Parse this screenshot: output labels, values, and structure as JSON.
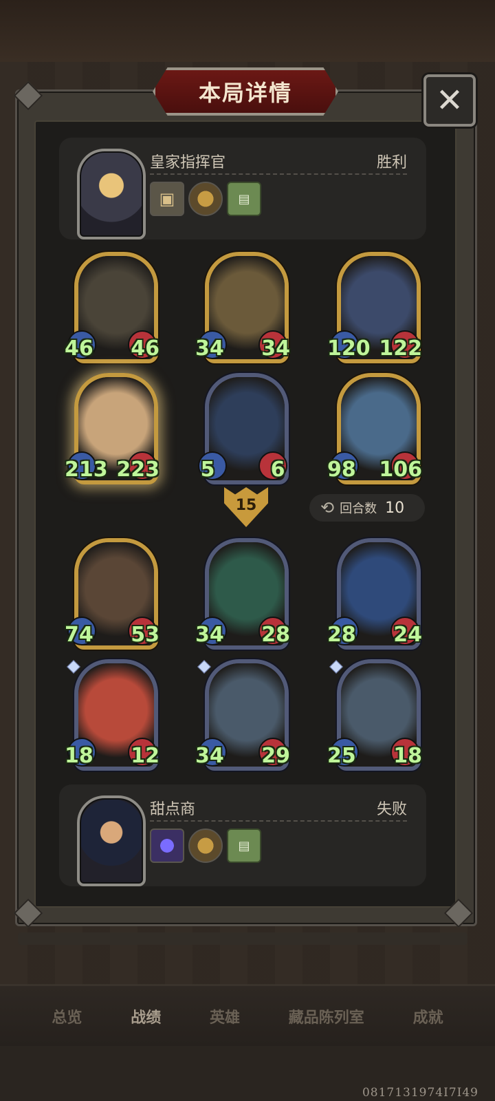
{
  "header": {
    "title": "本局详情",
    "close_label": "✕"
  },
  "top_player": {
    "name": "皇家指挥官",
    "result": "胜利",
    "items": [
      "photo",
      "watch",
      "book"
    ]
  },
  "bottom_player": {
    "name": "甜点商",
    "result": "失败",
    "items": [
      "gem",
      "watch",
      "book"
    ]
  },
  "top_units": [
    {
      "atk": "46",
      "hp": "46",
      "frame": "gold"
    },
    {
      "atk": "34",
      "hp": "34",
      "frame": "gold"
    },
    {
      "atk": "120",
      "hp": "122",
      "frame": "gold"
    },
    {
      "atk": "213",
      "hp": "223",
      "frame": "gold",
      "glow": true
    },
    {
      "atk": "5",
      "hp": "6",
      "frame": "silver"
    },
    {
      "atk": "98",
      "hp": "106",
      "frame": "gold"
    }
  ],
  "bottom_units": [
    {
      "atk": "74",
      "hp": "53",
      "frame": "gold"
    },
    {
      "atk": "34",
      "hp": "28",
      "frame": "silver"
    },
    {
      "atk": "28",
      "hp": "24",
      "frame": "silver"
    },
    {
      "atk": "18",
      "hp": "12",
      "frame": "silver"
    },
    {
      "atk": "34",
      "hp": "29",
      "frame": "silver"
    },
    {
      "atk": "25",
      "hp": "18",
      "frame": "silver"
    }
  ],
  "damage_badge": "15",
  "rounds": {
    "label": "回合数",
    "value": "10"
  },
  "tabs": [
    "总览",
    "战绩",
    "英雄",
    "藏品陈列室",
    "成就"
  ],
  "active_tab": 1,
  "uid": "0817131974I7I49"
}
